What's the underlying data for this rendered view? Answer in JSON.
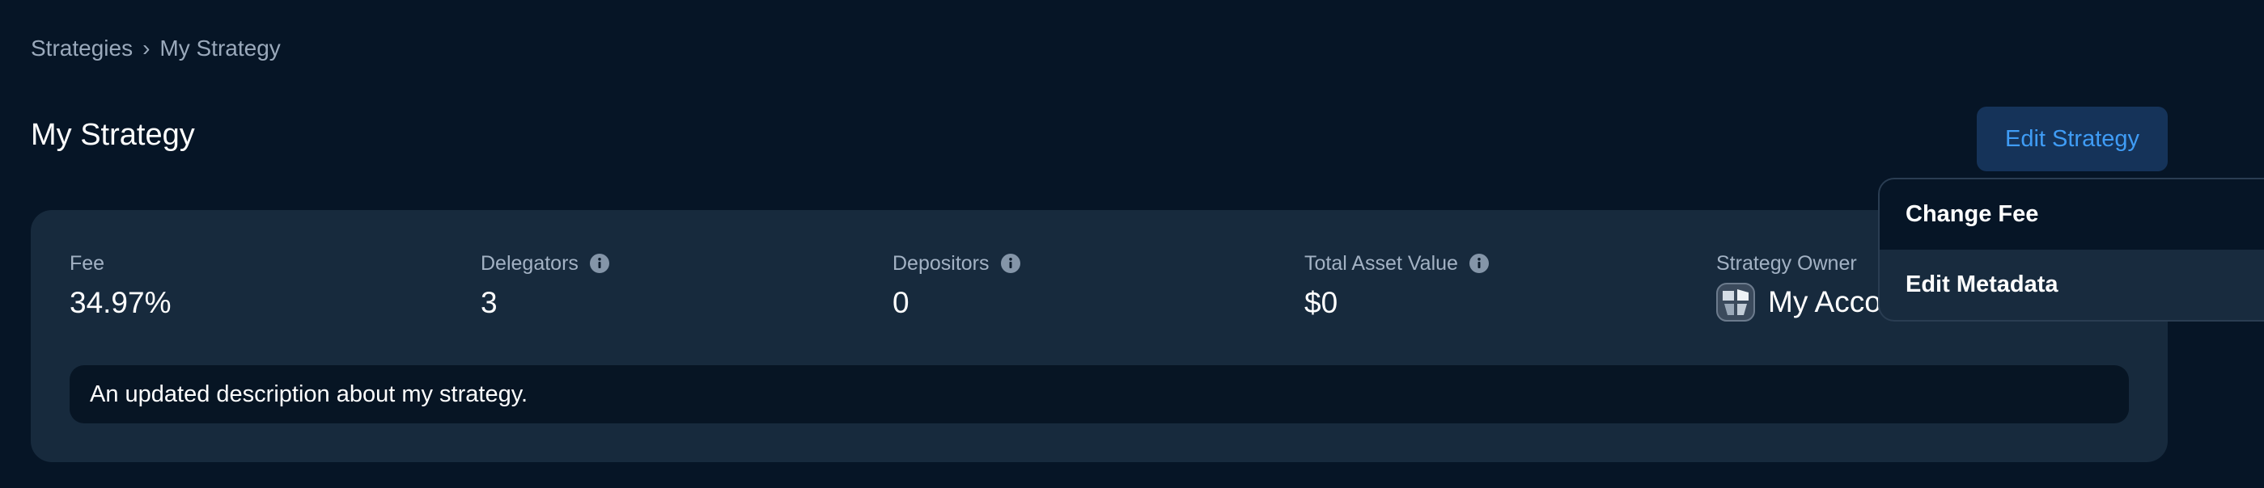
{
  "breadcrumb": {
    "parent": "Strategies",
    "separator": "›",
    "current": "My Strategy"
  },
  "page_title": "My Strategy",
  "edit_button_label": "Edit Strategy",
  "stats": {
    "fee": {
      "label": "Fee",
      "value": "34.97%"
    },
    "delegators": {
      "label": "Delegators",
      "value": "3",
      "icon": "info-icon"
    },
    "depositors": {
      "label": "Depositors",
      "value": "0",
      "icon": "info-icon"
    },
    "total_asset_value": {
      "label": "Total Asset Value",
      "value": "$0",
      "icon": "info-icon"
    },
    "owner": {
      "label": "Strategy Owner",
      "value": "My Acco",
      "icon": "avatar"
    }
  },
  "description": "An updated description about my strategy.",
  "dropdown": {
    "items": [
      {
        "label": "Change Fee"
      },
      {
        "label": "Edit Metadata"
      }
    ]
  },
  "colors": {
    "background": "#061526",
    "card": "#172a3d",
    "accent": "#3f9cf5",
    "button_bg": "#153359"
  }
}
